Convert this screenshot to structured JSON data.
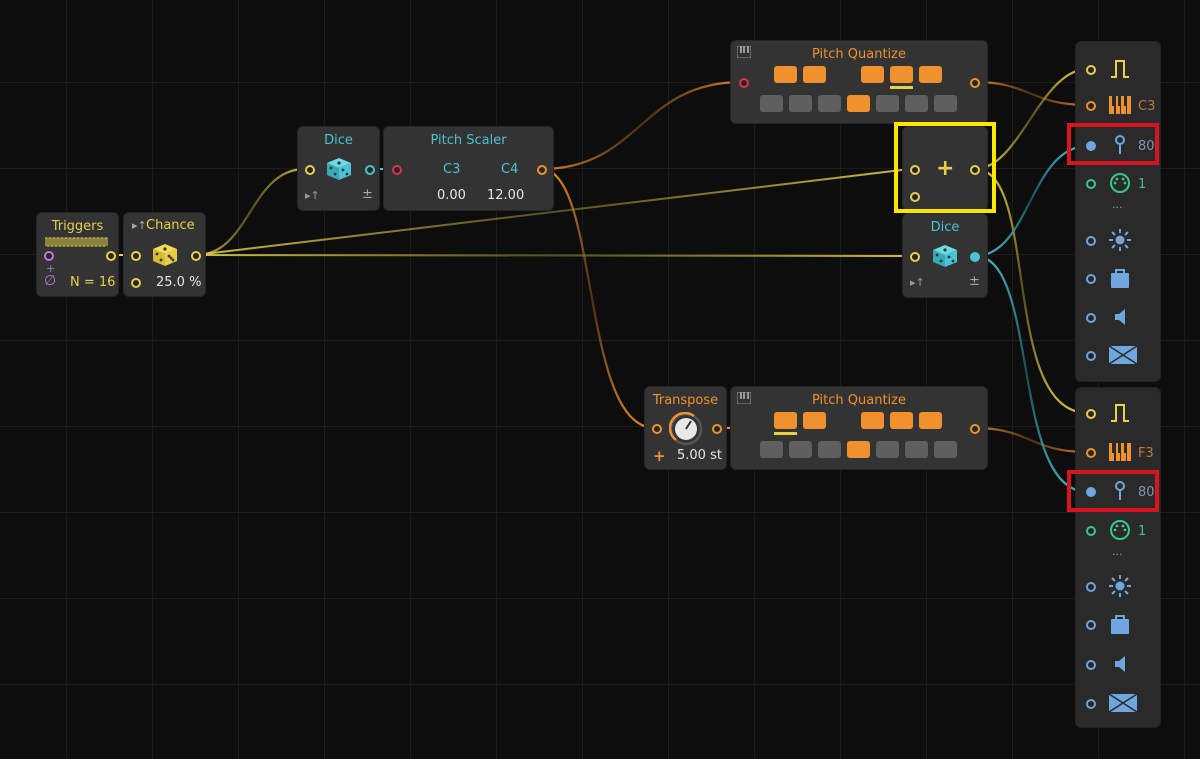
{
  "colors": {
    "background": "#0d0d0d",
    "node": "#333333",
    "yellow": "#e5d14a",
    "cyan": "#4cc3d1",
    "orange": "#f0912d",
    "red_port": "#e0304a",
    "highlight_yellow": "#ffe600",
    "highlight_red": "#d9141e"
  },
  "triggers": {
    "title": "Triggers",
    "count": "N = 16",
    "null_symbol": "∅",
    "plus": "+"
  },
  "chance": {
    "title": "Chance",
    "value": "25.0 %"
  },
  "dice_top": {
    "title": "Dice",
    "bipolar": "±"
  },
  "pitch_scaler": {
    "title": "Pitch Scaler",
    "low_note": "C3",
    "high_note": "C4",
    "low_value": "0.00",
    "high_value": "12.00"
  },
  "pitch_quantize_top": {
    "title": "Pitch Quantize",
    "upper_keys": [
      "on",
      "on",
      "gap",
      "on",
      "on",
      "on"
    ],
    "lower_keys": [
      "off",
      "off",
      "off",
      "on",
      "off",
      "off",
      "off"
    ]
  },
  "add_node": {
    "symbol": "+"
  },
  "dice_mid": {
    "title": "Dice",
    "bipolar": "±"
  },
  "transpose": {
    "title": "Transpose",
    "value": "5.00 st",
    "plus": "+"
  },
  "pitch_quantize_bottom": {
    "title": "Pitch Quantize",
    "upper_keys": [
      "on",
      "on",
      "gap",
      "on",
      "on",
      "on"
    ],
    "lower_keys": [
      "off",
      "off",
      "off",
      "on",
      "off",
      "off",
      "off"
    ]
  },
  "voice_top": {
    "pitch": "C3",
    "velocity": "80",
    "channel": "1",
    "ellipsis": "..."
  },
  "voice_bottom": {
    "pitch": "F3",
    "velocity": "80",
    "channel": "1",
    "ellipsis": "..."
  }
}
